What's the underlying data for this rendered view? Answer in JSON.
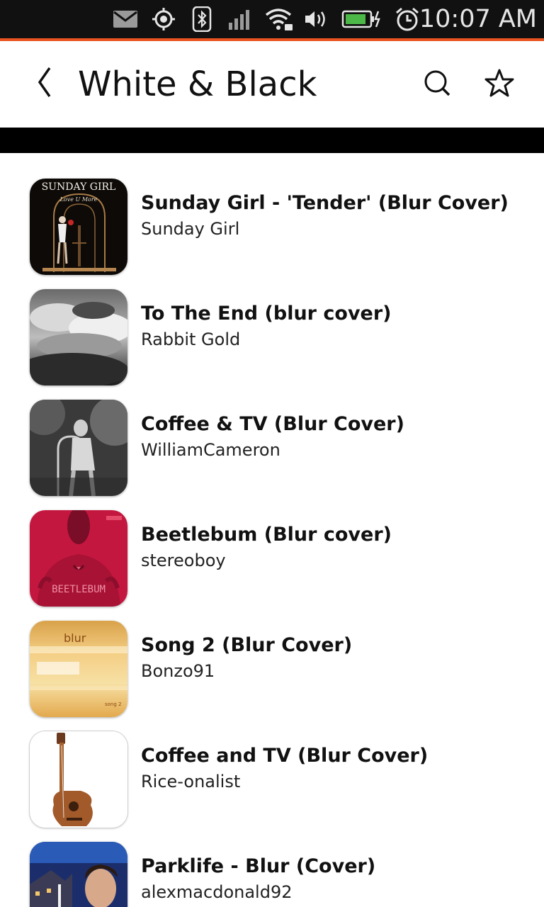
{
  "status_bar": {
    "time": "10:07 AM",
    "icons": [
      "mail-icon",
      "location-icon",
      "bluetooth-icon",
      "signal-icon",
      "wifi-icon",
      "volume-icon",
      "battery-icon",
      "alarm-icon"
    ],
    "accent_color": "#e95420"
  },
  "header": {
    "title": "White & Black",
    "back_icon": "chevron-left-icon",
    "search_icon": "search-icon",
    "favorite_icon": "star-icon"
  },
  "thumb_labels": {
    "sunday_girl_text": "SUNDAY GIRL",
    "sunday_girl_sub": "Love U More",
    "beetlebum_text": "BEETLEBUM",
    "song2_logo": "blur",
    "song2_text": "song 2"
  },
  "tracks": [
    {
      "title": "Sunday Girl -  'Tender' (Blur Cover)",
      "artist": "Sunday Girl"
    },
    {
      "title": "To The End (blur cover)",
      "artist": "Rabbit Gold"
    },
    {
      "title": "Coffee & TV (Blur Cover)",
      "artist": "WilliamCameron"
    },
    {
      "title": "Beetlebum (Blur cover)",
      "artist": "stereoboy"
    },
    {
      "title": "Song 2 (Blur Cover)",
      "artist": "Bonzo91"
    },
    {
      "title": "Coffee and TV (Blur Cover)",
      "artist": "Rice-onalist"
    },
    {
      "title": "Parklife - Blur (Cover)",
      "artist": "alexmacdonald92"
    }
  ]
}
